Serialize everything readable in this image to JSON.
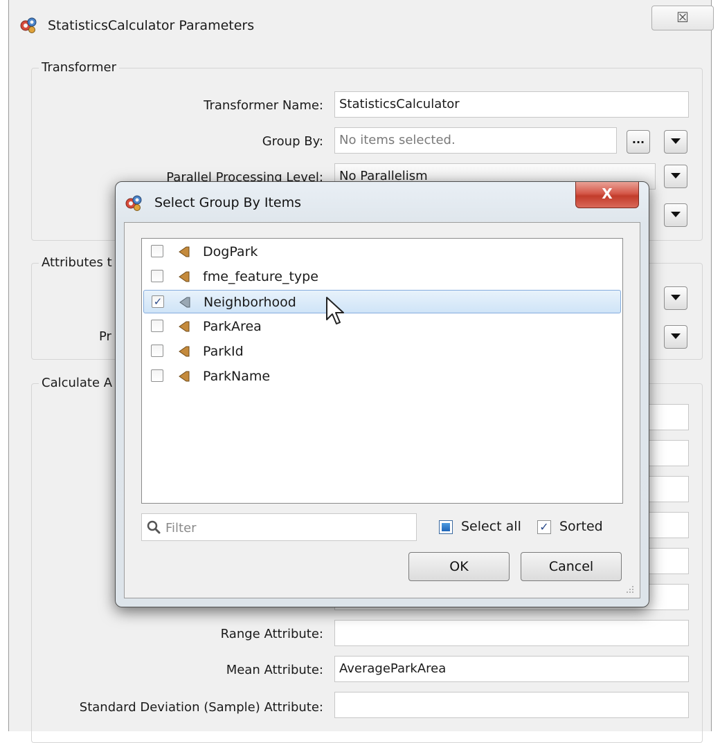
{
  "main_window": {
    "title": "StatisticsCalculator Parameters",
    "close_glyph": "☒",
    "transformer_group": {
      "title": "Transformer",
      "transformer_name_label": "Transformer Name:",
      "transformer_name_value": "StatisticsCalculator",
      "group_by_label": "Group By:",
      "group_by_placeholder": "No items selected.",
      "group_by_browse_label": "...",
      "parallel_label": "Parallel Processing Level:",
      "parallel_value": "No Parallelism"
    },
    "attributes_group": {
      "title_partial": "Attributes t",
      "row_label_partial": "Pr"
    },
    "calculate_group": {
      "title_partial": "Calculate A",
      "range_label": "Range Attribute:",
      "range_value": "",
      "mean_label": "Mean Attribute:",
      "mean_value": "AverageParkArea",
      "stddev_label": "Standard Deviation (Sample) Attribute:",
      "stddev_value": ""
    }
  },
  "dialog": {
    "title": "Select Group By Items",
    "close_glyph": "X",
    "items": [
      {
        "label": "DogPark",
        "checked": false,
        "selected": false
      },
      {
        "label": "fme_feature_type",
        "checked": false,
        "selected": false
      },
      {
        "label": "Neighborhood",
        "checked": true,
        "selected": true
      },
      {
        "label": "ParkArea",
        "checked": false,
        "selected": false
      },
      {
        "label": "ParkId",
        "checked": false,
        "selected": false
      },
      {
        "label": "ParkName",
        "checked": false,
        "selected": false
      }
    ],
    "filter_placeholder": "Filter",
    "select_all_label": "Select all",
    "select_all_state": "partial",
    "sorted_label": "Sorted",
    "sorted_checked": true,
    "ok_label": "OK",
    "cancel_label": "Cancel",
    "check_glyph": "✓"
  },
  "icons": [
    "fme-gears-icon",
    "attribute-arrow-icon",
    "search-icon",
    "dropdown-arrow-icon",
    "resize-grip-icon",
    "mouse-cursor-icon"
  ],
  "colors": {
    "dialog_close": "#c94a3b",
    "selection_bg": "#cfe4f7",
    "selection_border": "#84acdd",
    "attr_icon": "#c48a3c",
    "attr_icon_selected": "#9aa8b4"
  }
}
